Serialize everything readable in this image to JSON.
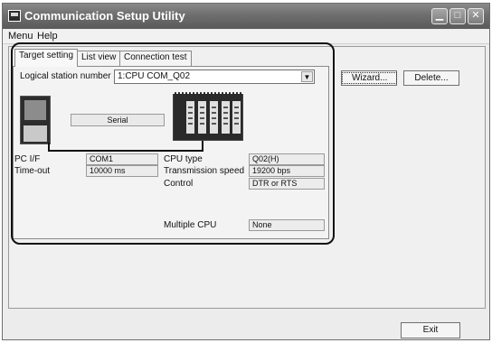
{
  "window": {
    "title": "Communication Setup Utility",
    "controls": {
      "minimize": "▁",
      "maximize": "□",
      "close": "✕"
    }
  },
  "menubar": {
    "items": [
      "Menu",
      "Help"
    ]
  },
  "tabs": [
    "Target setting",
    "List view",
    "Connection test"
  ],
  "target": {
    "station_label": "Logical station number",
    "station_value": "1:CPU COM_Q02",
    "dropdown_arrow": "▼",
    "serial_label": "Serial"
  },
  "buttons": {
    "wizard": "Wizard...",
    "delete": "Delete...",
    "exit": "Exit"
  },
  "fields": {
    "pc_if_label": "PC I/F",
    "pc_if_value": "COM1",
    "timeout_label": "Time-out",
    "timeout_value": "10000 ms",
    "cpu_type_label": "CPU type",
    "cpu_type_value": "Q02(H)",
    "speed_label": "Transmission speed",
    "speed_value": "19200 bps",
    "control_label": "Control",
    "control_value": "DTR or RTS",
    "multi_cpu_label": "Multiple CPU",
    "multi_cpu_value": "None"
  },
  "colors": {
    "titlebar": "#6e6e6e",
    "window_bg": "#ececec",
    "highlight": "#111111"
  },
  "icons": {
    "app": "utility-icon",
    "pc": "computer-icon",
    "plc": "plc-rack-icon"
  }
}
